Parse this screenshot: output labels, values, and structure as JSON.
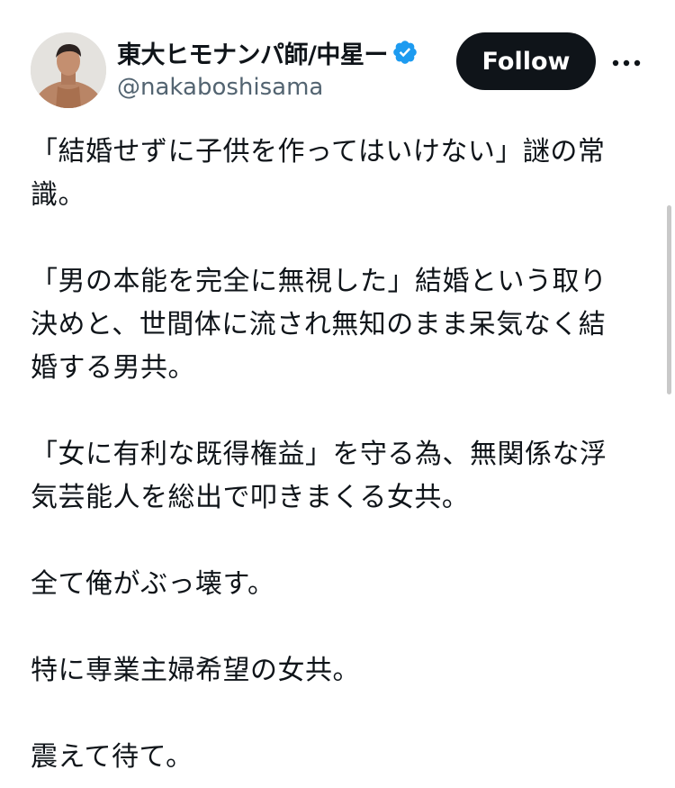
{
  "user": {
    "display_name": "東大ヒモナンパ師/中星ー",
    "handle": "@nakaboshisama",
    "verified": true,
    "avatar": "profile-photo"
  },
  "actions": {
    "follow_label": "Follow",
    "more_icon": "ellipsis-icon"
  },
  "tweet": {
    "lines": [
      "「結婚せずに子供を作ってはいけない」謎の常",
      "識。",
      "",
      "「男の本能を完全に無視した」結婚という取り",
      "決めと、世間体に流され無知のまま呆気なく結",
      "婚する男共。",
      "",
      "「女に有利な既得権益」を守る為、無関係な浮",
      "気芸能人を総出で叩きまくる女共。",
      "",
      "全て俺がぶっ壊す。",
      "",
      "特に専業主婦希望の女共。",
      "",
      "震えて待て。"
    ]
  },
  "colors": {
    "text": "#0f1419",
    "secondary": "#536471",
    "verified_blue": "#1d9bf0",
    "button_bg": "#0f1419",
    "button_text": "#ffffff"
  }
}
